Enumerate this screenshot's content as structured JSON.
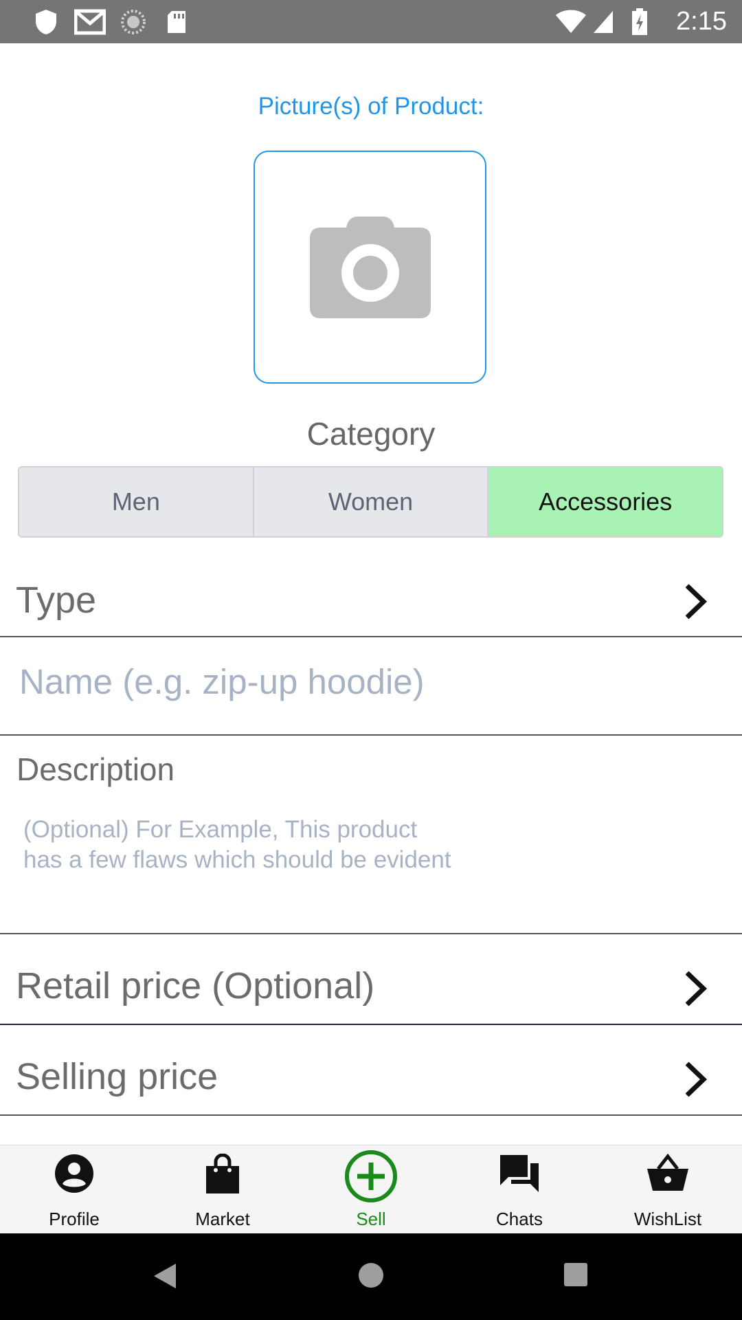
{
  "status_bar": {
    "time": "2:15",
    "left_icons": [
      "shield-icon",
      "gmail-icon",
      "sync-icon",
      "sd-card-icon"
    ],
    "right_icons": [
      "wifi-icon",
      "signal-icon",
      "battery-charging-icon"
    ]
  },
  "picture": {
    "label": "Picture(s) of Product:",
    "icon": "camera-icon",
    "accent_color": "#2196e8"
  },
  "category": {
    "label": "Category",
    "options": [
      "Men",
      "Women",
      "Accessories"
    ],
    "selected": "Accessories",
    "selected_color": "#a8f2b4"
  },
  "form": {
    "type_label": "Type",
    "name_placeholder": "Name (e.g. zip-up hoodie)",
    "description_label": "Description",
    "description_placeholder_line1": "(Optional) For Example, This product",
    "description_placeholder_line2": "has a few flaws which should be evident",
    "retail_price_label": "Retail price (Optional)",
    "selling_price_label": "Selling price"
  },
  "bottom_nav": {
    "items": [
      {
        "label": "Profile",
        "icon": "profile-icon"
      },
      {
        "label": "Market",
        "icon": "shopping-bag-icon"
      },
      {
        "label": "Sell",
        "icon": "add-circle-icon",
        "active": true
      },
      {
        "label": "Chats",
        "icon": "chats-icon"
      },
      {
        "label": "WishList",
        "icon": "basket-icon"
      }
    ],
    "active_color": "#1a8a1a"
  },
  "system_nav": [
    "back-icon",
    "home-icon",
    "recents-icon"
  ]
}
